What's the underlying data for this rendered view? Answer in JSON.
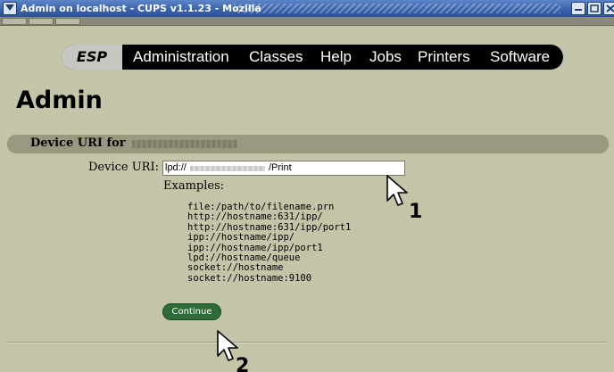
{
  "window": {
    "title": "Admin on localhost - CUPS v1.1.23 - Mozilla"
  },
  "nav": {
    "brand": "ESP",
    "items": [
      "Administration",
      "Classes",
      "Help",
      "Jobs",
      "Printers",
      "Software"
    ]
  },
  "page": {
    "heading": "Admin",
    "section_title": "Device URI for",
    "device_uri_label": "Device URI:",
    "device_uri_prefix": "lpd://",
    "device_uri_suffix": "/Print",
    "examples_label": "Examples:",
    "examples": [
      "file:/path/to/filename.prn",
      "http://hostname:631/ipp/",
      "http://hostname:631/ipp/port1",
      "ipp://hostname/ipp/",
      "ipp://hostname/ipp/port1",
      "lpd://hostname/queue",
      "socket://hostname",
      "socket://hostname:9100"
    ],
    "continue_label": "Continue"
  },
  "annotations": {
    "step1": "1",
    "step2": "2"
  },
  "colors": {
    "titlebar": "#3a63ac",
    "page_background": "#c4c4a8",
    "navbar": "#000000",
    "section_bar": "#999980",
    "continue_button": "#2f6b37"
  }
}
